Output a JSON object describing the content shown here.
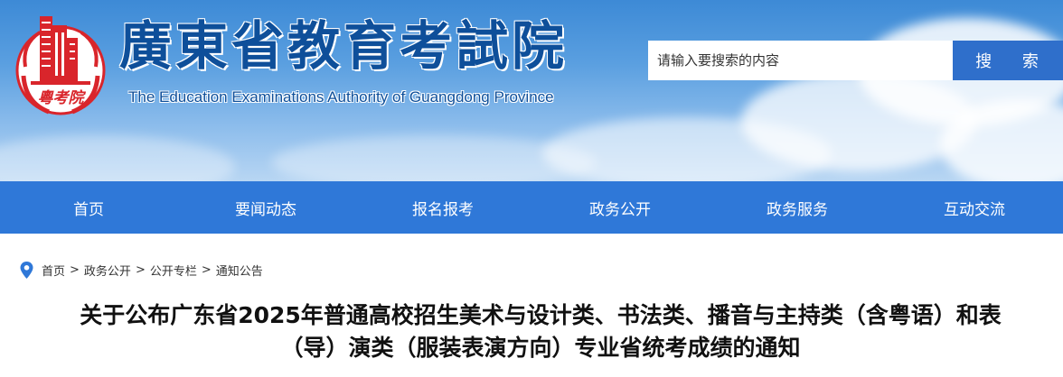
{
  "header": {
    "title": "廣東省教育考試院",
    "subtitle": "The Education Examinations Authority of Guangdong Province",
    "logo_text": "粵考院",
    "brand_color": "#d9252b"
  },
  "search": {
    "placeholder": "请输入要搜索的内容",
    "button_label": "搜 索"
  },
  "nav": {
    "items": [
      {
        "label": "首页"
      },
      {
        "label": "要闻动态"
      },
      {
        "label": "报名报考"
      },
      {
        "label": "政务公开"
      },
      {
        "label": "政务服务"
      },
      {
        "label": "互动交流"
      }
    ],
    "background": "#2f78d8"
  },
  "breadcrumb": {
    "icon": "location-pin-icon",
    "items": [
      "首页",
      "政务公开",
      "公开专栏",
      "通知公告"
    ],
    "separator": ">"
  },
  "article": {
    "title_line1": "关于公布广东省2025年普通高校招生美术与设计类、书法类、播音与主持类（含粤语）和表",
    "title_line2": "（导）演类（服装表演方向）专业省统考成绩的通知"
  }
}
